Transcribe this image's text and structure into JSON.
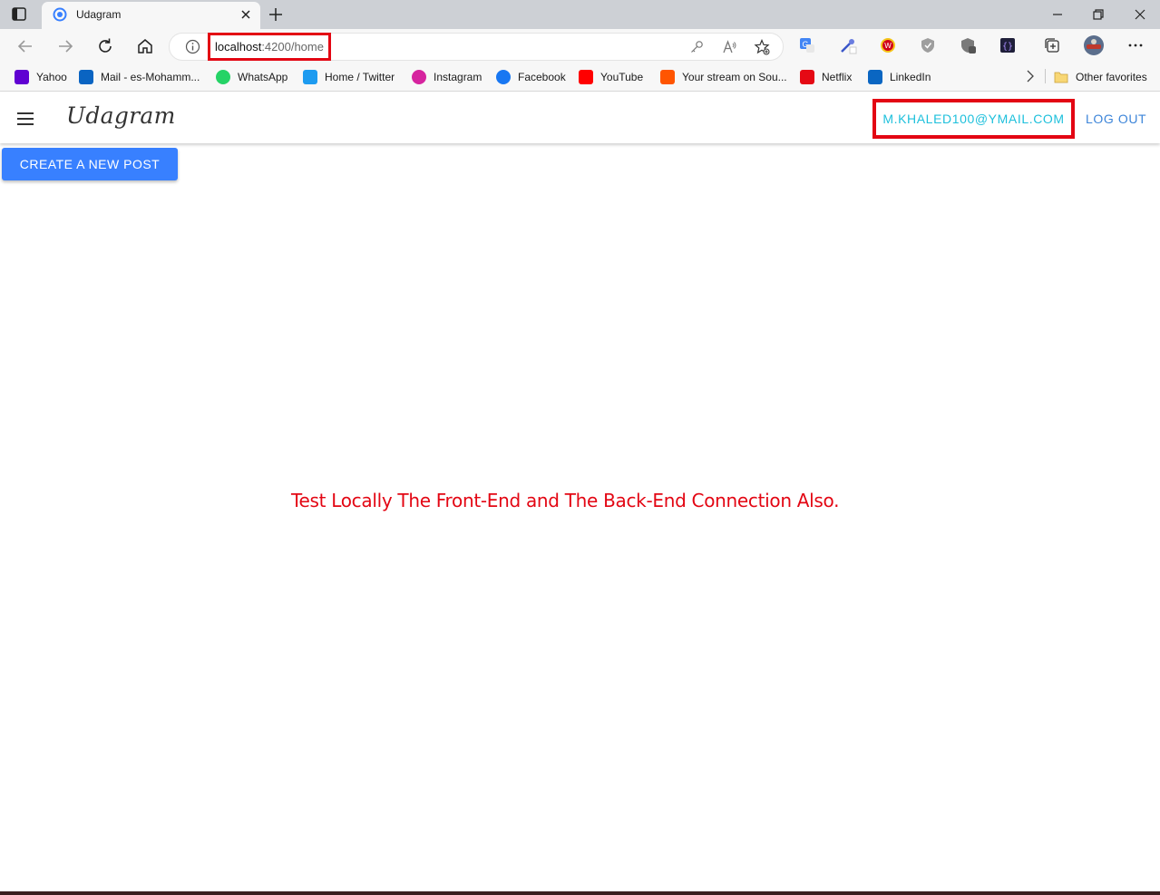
{
  "browser": {
    "tab": {
      "title": "Udagram"
    },
    "address_bar": {
      "host": "localhost",
      "path": ":4200/home"
    },
    "favorites": [
      {
        "label": "Yahoo",
        "icon": "yahoo-icon",
        "color": "#6001d2"
      },
      {
        "label": "Mail - es-Mohamm...",
        "icon": "outlook-icon",
        "color": "#0a64c2"
      },
      {
        "label": "WhatsApp",
        "icon": "whatsapp-icon",
        "color": "#25d366"
      },
      {
        "label": "Home / Twitter",
        "icon": "twitter-icon",
        "color": "#1d9bf0"
      },
      {
        "label": "Instagram",
        "icon": "instagram-icon",
        "color": "#d6249f"
      },
      {
        "label": "Facebook",
        "icon": "facebook-icon",
        "color": "#1877f2"
      },
      {
        "label": "YouTube",
        "icon": "youtube-icon",
        "color": "#ff0000"
      },
      {
        "label": "Your stream on Sou...",
        "icon": "soundcloud-icon",
        "color": "#ff5500"
      },
      {
        "label": "Netflix",
        "icon": "netflix-icon",
        "color": "#e50914"
      },
      {
        "label": "LinkedIn",
        "icon": "linkedin-icon",
        "color": "#0a66c2"
      }
    ],
    "other_favorites": "Other favorites"
  },
  "app": {
    "brand": "Udagram",
    "user_email": "M.KHALED100@YMAIL.COM",
    "logout_label": "LOG OUT",
    "create_post_label": "CREATE A NEW POST",
    "annotation": "Test Locally The Front-End and The Back-End Connection Also."
  },
  "colors": {
    "highlight": "#e30613",
    "primary_button": "#3880ff",
    "email_text": "#1ec0dc",
    "logout_text": "#3d85d9"
  }
}
